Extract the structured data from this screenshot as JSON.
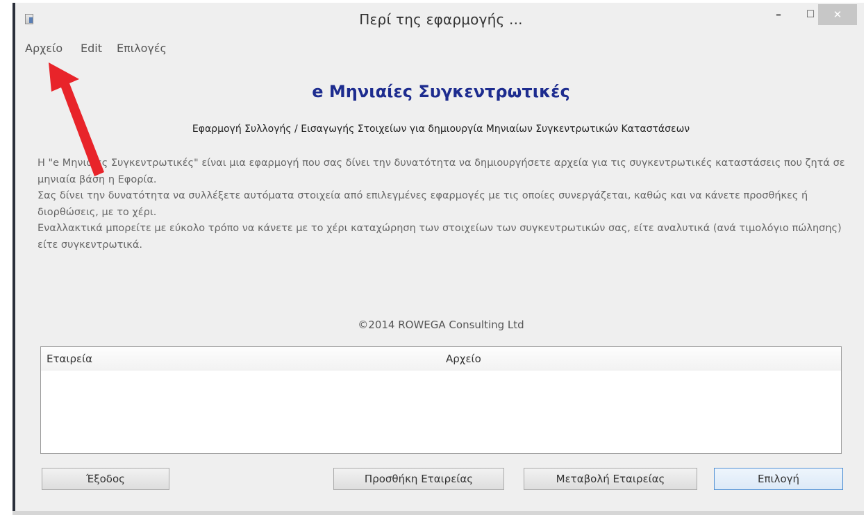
{
  "window": {
    "title": "Περί της εφαρμογής ...",
    "controls": {
      "minimize": "–",
      "maximize": "☐",
      "close": "✕"
    }
  },
  "menu": {
    "items": [
      {
        "label": "Αρχείο"
      },
      {
        "label": "Edit"
      },
      {
        "label": "Επιλογές"
      }
    ]
  },
  "about": {
    "heading": "e Μηνιαίες Συγκεντρωτικές",
    "subtitle": "Εφαρμογή Συλλογής / Εισαγωγής Στοιχείων για δημιουργία Μηνιαίων Συγκεντρωτικών Καταστάσεων",
    "description": [
      "Η \"e Μηνιαίες Συγκεντρωτικές\" είναι μια εφαρμογή που σας δίνει την δυνατότητα να δημιουργήσετε αρχεία για τις συγκεντρωτικές καταστάσεις που ζητά σε μηνιαία βάση η Εφορία.",
      "Σας δίνει την δυνατότητα να συλλέξετε αυτόματα στοιχεία από επιλεγμένες εφαρμογές με τις οποίες συνεργάζεται, καθώς και να κάνετε προσθήκες ή διορθώσεις, με το χέρι.",
      "Εναλλακτικά μπορείτε με εύκολο τρόπο να κάνετε με το χέρι καταχώρηση των στοιχείων των συγκεντρωτικών σας, είτε αναλυτικά (ανά τιμολόγιο πώλησης) είτε συγκεντρωτικά."
    ],
    "copyright": "©2014 ROWEGA Consulting Ltd"
  },
  "companies_table": {
    "columns": [
      "Εταιρεία",
      "Αρχείο"
    ],
    "rows": []
  },
  "buttons": {
    "exit": "Έξοδος",
    "add_company": "Προσθήκη Εταιρείας",
    "change_company": "Μεταβολή Εταιρείας",
    "select": "Επιλογή"
  },
  "annotation": {
    "arrow_color": "#e8242a",
    "arrow_target": "Αρχείο"
  },
  "colors": {
    "heading": "#1d2c8f",
    "window_bg": "#efefef",
    "close_button": "#c7c7c7"
  }
}
